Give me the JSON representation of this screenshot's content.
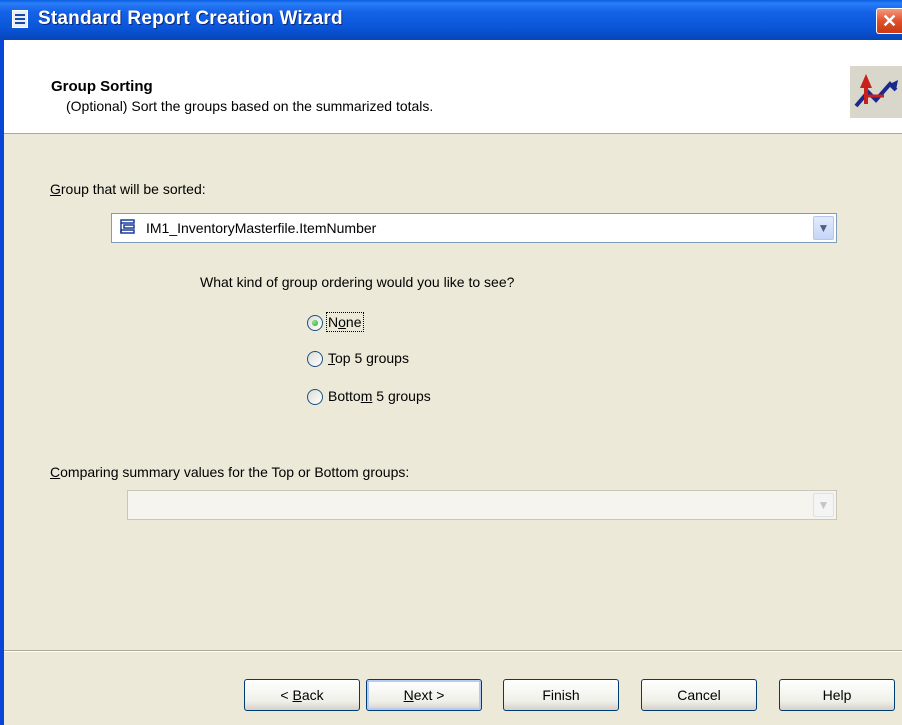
{
  "window": {
    "title": "Standard Report Creation Wizard",
    "close_glyph": "✕"
  },
  "header": {
    "step_title": "Group Sorting",
    "step_description": "(Optional) Sort the groups based on the summarized totals.",
    "icon": "sort-chart-icon"
  },
  "group_sort": {
    "label_mnemonic": "G",
    "label_rest": "roup that will be sorted:",
    "selected_value": "IM1_InventoryMasterfile.ItemNumber",
    "value_icon": "group-field-icon"
  },
  "ordering": {
    "question": "What kind of group ordering would you like to see?",
    "options": [
      {
        "pre": "N",
        "mnemonic": "o",
        "post": "ne",
        "checked": true
      },
      {
        "pre": "",
        "mnemonic": "T",
        "post": "op 5 groups",
        "checked": false
      },
      {
        "pre": "Botto",
        "mnemonic": "m",
        "post": " 5 groups",
        "checked": false
      }
    ]
  },
  "comparing": {
    "label_mnemonic": "C",
    "label_rest": "omparing summary values for the Top or Bottom groups:",
    "selected_value": "",
    "enabled": false
  },
  "buttons": {
    "back": {
      "pre": "< ",
      "mnemonic": "B",
      "post": "ack"
    },
    "next": {
      "pre": "",
      "mnemonic": "N",
      "post": "ext >"
    },
    "finish": "Finish",
    "cancel": "Cancel",
    "help": "Help"
  },
  "colors": {
    "titlebar": "#0a55d8",
    "face": "#ece9d8",
    "header_bg": "#ffffff"
  }
}
